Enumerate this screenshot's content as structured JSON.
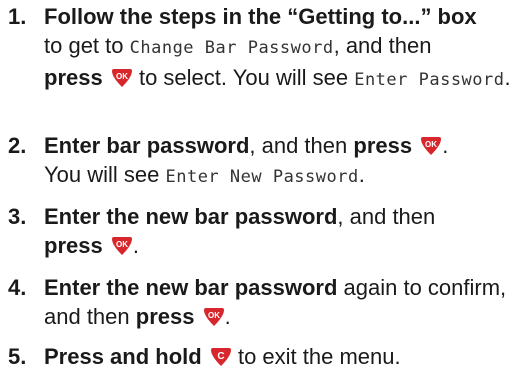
{
  "steps": [
    {
      "num": "1.",
      "bold1": "Follow the steps in the “Getting to...” box",
      "t1": " to get to ",
      "mono1": "Change Bar Password",
      "t2": ", and then ",
      "bold2": "press",
      "t3": " to select. You will see ",
      "mono2": "Enter Password",
      "t4": "."
    },
    {
      "num": "2.",
      "bold1": "Enter bar password",
      "t1": ", and then ",
      "bold2": "press",
      "t2": ".",
      "t3": "You will see ",
      "mono1": "Enter New Password",
      "t4": "."
    },
    {
      "num": "3.",
      "bold1": "Enter the new bar password",
      "t1": ", and then",
      "bold2": "press",
      "t2": "."
    },
    {
      "num": "4.",
      "bold1": "Enter the new bar password",
      "t1": " again to confirm, and then ",
      "bold2": "press",
      "t2": "."
    },
    {
      "num": "5.",
      "bold1": "Press and hold",
      "t1": " to exit the menu."
    }
  ],
  "icons": {
    "ok_label": "OK",
    "ok_icon": "ok-key-icon",
    "c_label": "C",
    "c_icon": "clear-key-icon",
    "key_color": "#d7262c"
  }
}
